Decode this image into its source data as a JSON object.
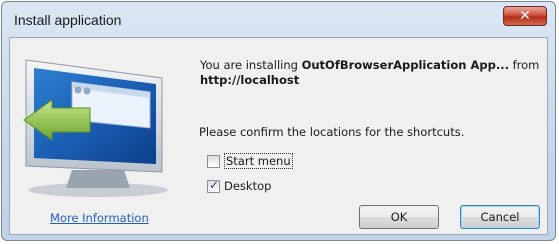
{
  "window": {
    "title": "Install application",
    "close_glyph": "✕"
  },
  "message": {
    "prefix": "You are installing ",
    "app_name": "OutOfBrowserApplication App...",
    "middle": " from",
    "source": "http://localhost"
  },
  "confirm_text": "Please confirm the locations for the shortcuts.",
  "shortcuts": [
    {
      "label": "Start menu",
      "checked": false
    },
    {
      "label": "Desktop",
      "checked": true
    }
  ],
  "check_glyph": "✓",
  "more_info_label": "More Information",
  "buttons": {
    "ok": "OK",
    "cancel": "Cancel"
  },
  "icons": {
    "illustration": "monitor-with-install-arrow-icon"
  },
  "colors": {
    "link": "#1f5fbf",
    "arrow": "#8bc34a",
    "close": "#c8412f"
  }
}
